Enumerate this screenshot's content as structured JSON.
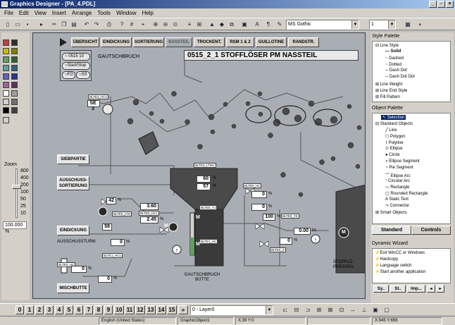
{
  "window": {
    "title": "Graphics Designer - [PA_4.PDL]"
  },
  "menu": [
    "File",
    "Edit",
    "View",
    "Insert",
    "Arrange",
    "Tools",
    "Window",
    "Help"
  ],
  "toolbar": {
    "font": "MS Gothic",
    "size": "1"
  },
  "zoom": {
    "label": "Zoom",
    "ticks": [
      "800",
      "400",
      "200",
      "100",
      "50",
      "25",
      "10"
    ],
    "value": "100.000 %"
  },
  "nav": [
    "ÜBERSICHT",
    "EINDICKUNG",
    "SORTIERUNG",
    "NASSTEIL",
    "TROCKENT.",
    "RSM 1 & 2",
    "GUILLOTINE",
    "RANDSTR."
  ],
  "nav_active": "NASSTEIL",
  "page_title": "0515_2_1 STOFFLÖSER PM NASSTEIL",
  "radio": {
    "id": "0515 10",
    "start_stop": "Start/Stop",
    "fg": "FG",
    "ss": "SS"
  },
  "gautschbruch_label": "GAUTSCHBRUCH",
  "side_buttons": {
    "siebpartie": "SIEBPARTIE",
    "ausschuss": "AUSSCHUSS-SORTIERUNG",
    "eindickung": "EINDICKUNG",
    "mischbutte": "MISCHBUTTE"
  },
  "ausschussturm": "AUSSCHUSSTURM",
  "se_label": "SE 3",
  "values": {
    "v1": "60",
    "v2": "57",
    "u1": "%",
    "v3": "42",
    "v4": "3.60",
    "v5": "2.45",
    "v6": "58",
    "v7": "0",
    "v8": "0",
    "v9": "0",
    "v10": "0",
    "v11": "0",
    "v12": "100",
    "v13": "0.00",
    "v14": "0"
  },
  "units": {
    "pct": "%",
    "ls": "l/s"
  },
  "tags": [
    "BLTE0_LTW1",
    "BLTE0_Y1",
    "BLTE1_HC",
    "BLTE0_LTO",
    "BLTE0_HC1",
    "BLTE1_HC1",
    "BLTE0_H2",
    "BLTE0_HC",
    "BLTE0_YE",
    "BLTE0_Z",
    "BLTE3_HC2"
  ],
  "pump_m": "M",
  "gautschbruch_butte": "GAUTSCHBRUCH BÜTTE",
  "stoffloeser": "STOFFLÖ PRESSEN",
  "pages": [
    "0",
    "1",
    "2",
    "3",
    "4",
    "5",
    "6",
    "7",
    "8",
    "9",
    "10",
    "11",
    "12",
    "13",
    "14",
    "15"
  ],
  "layer": "0 - Layer0",
  "status": {
    "lang": "English (United States)",
    "obj": "GraphicObject1",
    "pos": "X:39 Y:0",
    "size": "X:945 Y:656"
  },
  "style_palette": {
    "title": "Style Palette",
    "items": [
      "Line Style",
      "Solid",
      "Dashed",
      "Dotted",
      "Dash Dot",
      "Dash Dot Dot",
      "Line Weight",
      "Line End Style",
      "Fill Pattern"
    ]
  },
  "object_palette": {
    "title": "Object Palette",
    "items": [
      "Selection",
      "Standard Objects",
      "Line",
      "Polygon",
      "Polyline",
      "Ellipse",
      "Circle",
      "Ellipse Segment",
      "Pie Segment",
      "Ellipse Arc",
      "Circular Arc",
      "Rectangle",
      "Rounded Rectangle",
      "Static Text",
      "Connector",
      "Smart Objects"
    ],
    "tab_standard": "Standard",
    "tab_controls": "Controls"
  },
  "wizard": {
    "title": "Dynamic Wizard",
    "items": [
      "Exit WinCC or Windows",
      "Hardcopy",
      "Language switch",
      "Start another application"
    ],
    "tabs": [
      "Sy..",
      "St..",
      "Imp..."
    ]
  },
  "colors": {
    "canvas": "#a9aeb5",
    "titlebar": "#0a246a",
    "tank": "#4a4a4a",
    "pump": "#2a2a2a"
  }
}
